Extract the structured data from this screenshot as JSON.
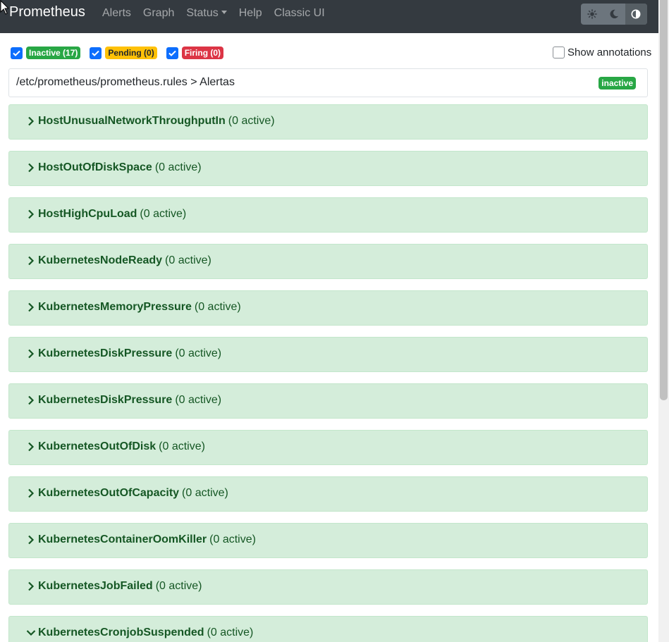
{
  "navbar": {
    "brand": "Prometheus",
    "links": [
      {
        "label": "Alerts"
      },
      {
        "label": "Graph"
      },
      {
        "label": "Status"
      },
      {
        "label": "Help"
      },
      {
        "label": "Classic UI"
      }
    ],
    "theme_buttons": [
      {
        "icon": "sun-icon",
        "active": false
      },
      {
        "icon": "moon-icon",
        "active": false
      },
      {
        "icon": "adjust-icon",
        "active": true
      }
    ]
  },
  "filters": {
    "inactive": {
      "label": "Inactive (17)",
      "checked": true,
      "color": "#28a745"
    },
    "pending": {
      "label": "Pending (0)",
      "checked": true,
      "color": "#ffc107"
    },
    "firing": {
      "label": "Firing (0)",
      "checked": true,
      "color": "#dc3545"
    }
  },
  "show_annotations": {
    "label": "Show annotations",
    "checked": false
  },
  "rule_file": {
    "path": "/etc/prometheus/prometheus.rules > Alertas",
    "state": "inactive"
  },
  "rules": [
    {
      "name": "HostUnusualNetworkThroughputIn",
      "count": "(0 active)",
      "expanded": false
    },
    {
      "name": "HostOutOfDiskSpace",
      "count": "(0 active)",
      "expanded": false
    },
    {
      "name": "HostHighCpuLoad",
      "count": "(0 active)",
      "expanded": false
    },
    {
      "name": "KubernetesNodeReady",
      "count": "(0 active)",
      "expanded": false
    },
    {
      "name": "KubernetesMemoryPressure",
      "count": "(0 active)",
      "expanded": false
    },
    {
      "name": "KubernetesDiskPressure",
      "count": "(0 active)",
      "expanded": false
    },
    {
      "name": "KubernetesDiskPressure",
      "count": "(0 active)",
      "expanded": false
    },
    {
      "name": "KubernetesOutOfDisk",
      "count": "(0 active)",
      "expanded": false
    },
    {
      "name": "KubernetesOutOfCapacity",
      "count": "(0 active)",
      "expanded": false
    },
    {
      "name": "KubernetesContainerOomKiller",
      "count": "(0 active)",
      "expanded": false
    },
    {
      "name": "KubernetesJobFailed",
      "count": "(0 active)",
      "expanded": false
    },
    {
      "name": "KubernetesCronjobSuspended",
      "count": "(0 active)",
      "expanded": true
    }
  ]
}
